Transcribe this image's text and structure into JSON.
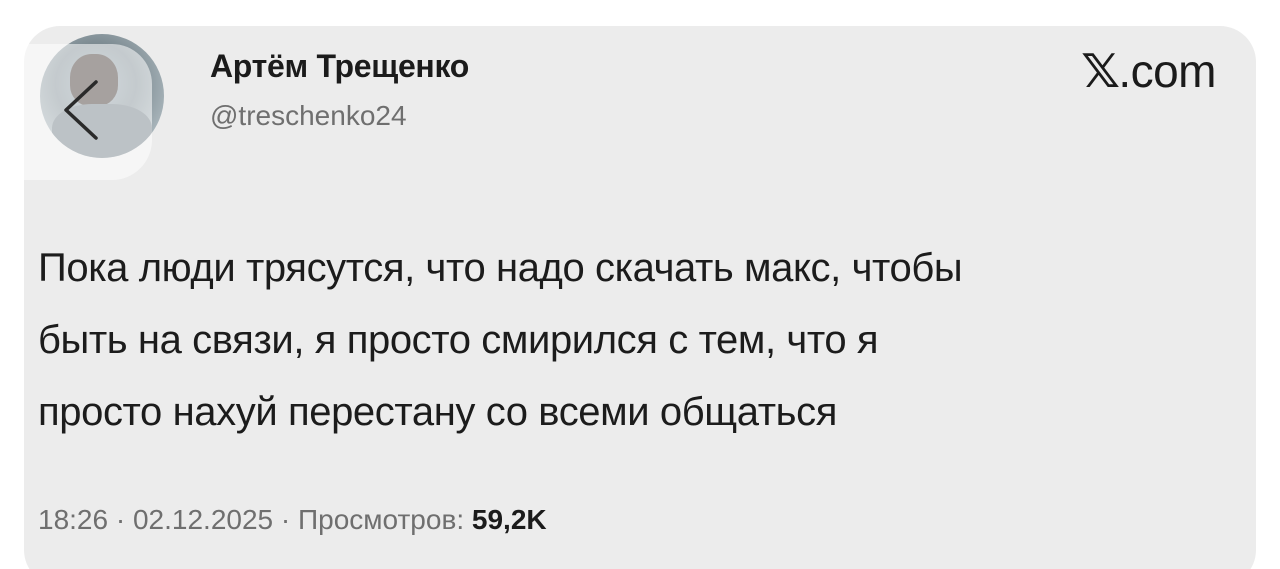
{
  "author": {
    "name": "Артём Трещенко",
    "handle": "@treschenko24"
  },
  "brand": {
    "mark": "𝕏",
    "domain": ".com"
  },
  "post": {
    "lines": [
      "Пока люди трясутся, что надо скачать макс, чтобы",
      "быть на связи, я просто смирился с тем, что я",
      "просто нахуй перестану со всеми общаться"
    ]
  },
  "meta": {
    "time": "18:26",
    "separator": " · ",
    "date": "02.12.2025",
    "views_label": "Просмотров:",
    "views_count": "59,2K"
  },
  "icons": {
    "back": "chevron-left-icon",
    "avatar": "profile-photo"
  },
  "colors": {
    "card_background": "#ececec",
    "primary_text": "#1c1c1c",
    "secondary_text": "#6f6f6f"
  }
}
